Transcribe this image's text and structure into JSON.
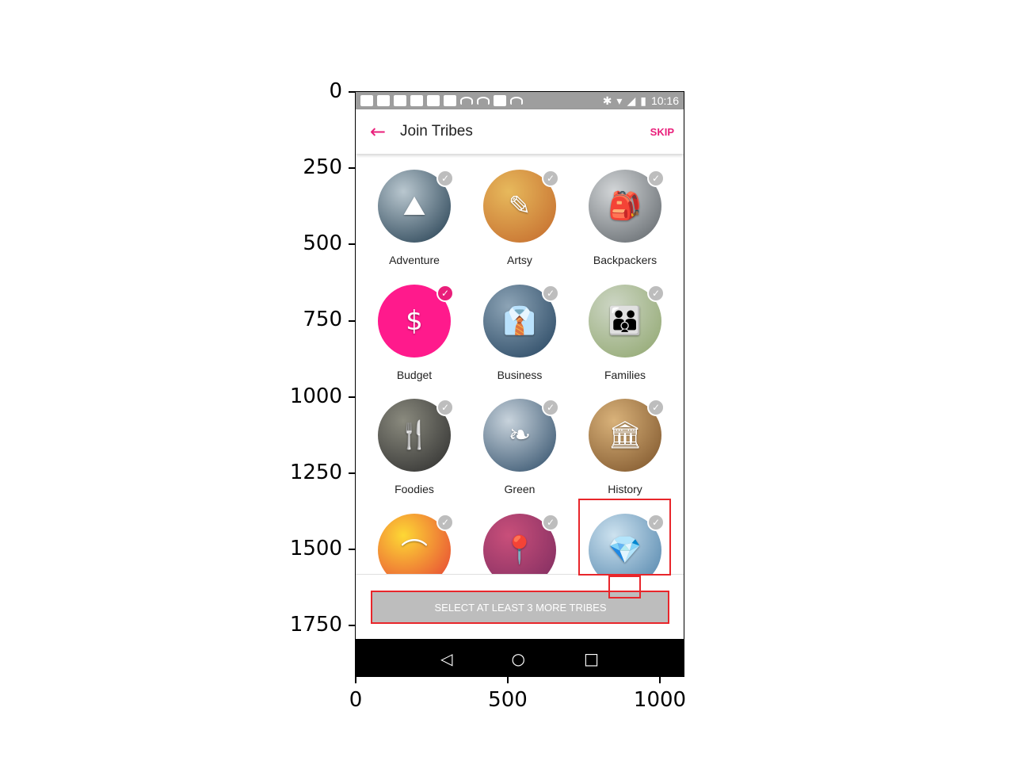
{
  "status_bar": {
    "time": "10:16"
  },
  "app_bar": {
    "back_glyph": "←",
    "title": "Join Tribes",
    "skip_label": "SKIP"
  },
  "tribes": [
    {
      "label": "Adventure",
      "icon": "mountain-photo-icon",
      "glyph": "⛰",
      "selected": false,
      "colors": [
        "#1f3a4d",
        "#b9c7cf"
      ]
    },
    {
      "label": "Artsy",
      "icon": "paintbrush-icon",
      "glyph": "✎",
      "selected": false,
      "colors": [
        "#c3682b",
        "#e7b95c"
      ]
    },
    {
      "label": "Backpackers",
      "icon": "backpack-icon",
      "glyph": "🎒",
      "selected": false,
      "colors": [
        "#5b6166",
        "#d3d6d8"
      ]
    },
    {
      "label": "Budget",
      "icon": "price-tag-icon",
      "glyph": "$",
      "selected": true,
      "colors": [
        "#ff1a8c",
        "#ff1a8c"
      ]
    },
    {
      "label": "Business",
      "icon": "necktie-icon",
      "glyph": "👔",
      "selected": false,
      "colors": [
        "#23425e",
        "#8da4b6"
      ]
    },
    {
      "label": "Families",
      "icon": "family-icon",
      "glyph": "👪",
      "selected": false,
      "colors": [
        "#8ea56c",
        "#cdd6c5"
      ]
    },
    {
      "label": "Foodies",
      "icon": "fork-knife-icon",
      "glyph": "🍴",
      "selected": false,
      "colors": [
        "#2b2b2b",
        "#8a8a7e"
      ]
    },
    {
      "label": "Green",
      "icon": "leaf-icon",
      "glyph": "❧",
      "selected": false,
      "colors": [
        "#2b4a66",
        "#c8d3dc"
      ]
    },
    {
      "label": "History",
      "icon": "museum-icon",
      "glyph": "🏛",
      "selected": false,
      "colors": [
        "#7a5128",
        "#d9b27a"
      ]
    },
    {
      "label": "",
      "icon": "rainbow-icon",
      "glyph": "⌒",
      "selected": false,
      "colors": [
        "#e53935",
        "#fdd835"
      ]
    },
    {
      "label": "",
      "icon": "map-pin-icon",
      "glyph": "📍",
      "selected": false,
      "colors": [
        "#7b2b5f",
        "#c94f7a"
      ]
    },
    {
      "label": "",
      "icon": "diamond-icon",
      "glyph": "💎",
      "selected": false,
      "colors": [
        "#4a7fa8",
        "#cde2ef"
      ]
    }
  ],
  "check_glyph": "✓",
  "cta_label": "SELECT AT LEAST 3 MORE TRIBES",
  "nav": {
    "back": "◁",
    "home": "○",
    "recents": "□"
  },
  "axes": {
    "y_ticks": [
      "0",
      "250",
      "500",
      "750",
      "1000",
      "1250",
      "1500",
      "1750"
    ],
    "x_ticks": [
      "0",
      "500",
      "1000"
    ]
  },
  "accent_color": "#e91e7a",
  "annotation_color": "#e8262b"
}
